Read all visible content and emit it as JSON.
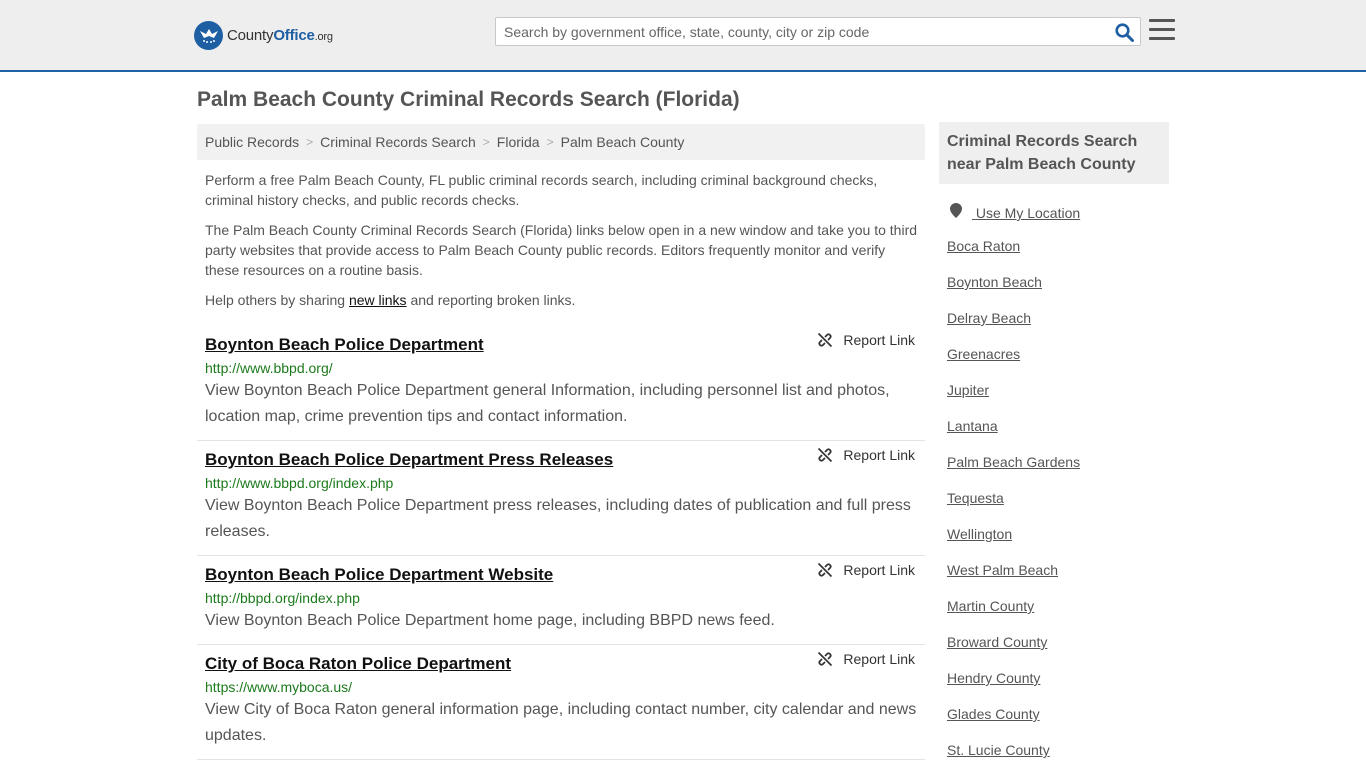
{
  "header": {
    "logo": {
      "brand_part1": "County",
      "brand_part2": "Office",
      "tld": ".org"
    },
    "search": {
      "placeholder": "Search by government office, state, county, city or zip code",
      "value": ""
    },
    "icons": {
      "search": "search-icon",
      "menu": "hamburger-menu-icon"
    }
  },
  "page": {
    "title": "Palm Beach County Criminal Records Search (Florida)"
  },
  "breadcrumb": [
    "Public Records",
    "Criminal Records Search",
    "Florida",
    "Palm Beach County"
  ],
  "intro": {
    "p1": "Perform a free Palm Beach County, FL public criminal records search, including criminal background checks, criminal history checks, and public records checks.",
    "p2": "The Palm Beach County Criminal Records Search (Florida) links below open in a new window and take you to third party websites that provide access to Palm Beach County public records. Editors frequently monitor and verify these resources on a routine basis.",
    "p3_before": "Help others by sharing ",
    "p3_link": "new links",
    "p3_after": " and reporting broken links."
  },
  "results": [
    {
      "title": "Boynton Beach Police Department",
      "url": "http://www.bbpd.org/",
      "description": "View Boynton Beach Police Department general Information, including personnel list and photos, location map, crime prevention tips and contact information.",
      "report_label": "Report Link"
    },
    {
      "title": "Boynton Beach Police Department Press Releases",
      "url": "http://www.bbpd.org/index.php",
      "description": "View Boynton Beach Police Department press releases, including dates of publication and full press releases.",
      "report_label": "Report Link"
    },
    {
      "title": "Boynton Beach Police Department Website",
      "url": "http://bbpd.org/index.php",
      "description": "View Boynton Beach Police Department home page, including BBPD news feed.",
      "report_label": "Report Link"
    },
    {
      "title": "City of Boca Raton Police Department",
      "url": "https://www.myboca.us/",
      "description": "View City of Boca Raton general information page, including contact number, city calendar and news updates.",
      "report_label": "Report Link"
    }
  ],
  "sidebar": {
    "heading": "Criminal Records Search near Palm Beach County",
    "use_location": "Use My Location",
    "links": [
      "Boca Raton",
      "Boynton Beach",
      "Delray Beach",
      "Greenacres",
      "Jupiter",
      "Lantana",
      "Palm Beach Gardens",
      "Tequesta",
      "Wellington",
      "West Palm Beach",
      "Martin County",
      "Broward County",
      "Hendry County",
      "Glades County",
      "St. Lucie County"
    ]
  },
  "colors": {
    "accent": "#1e5fa3",
    "url_green": "#1c7a1c",
    "header_bg": "#eeeeee"
  }
}
